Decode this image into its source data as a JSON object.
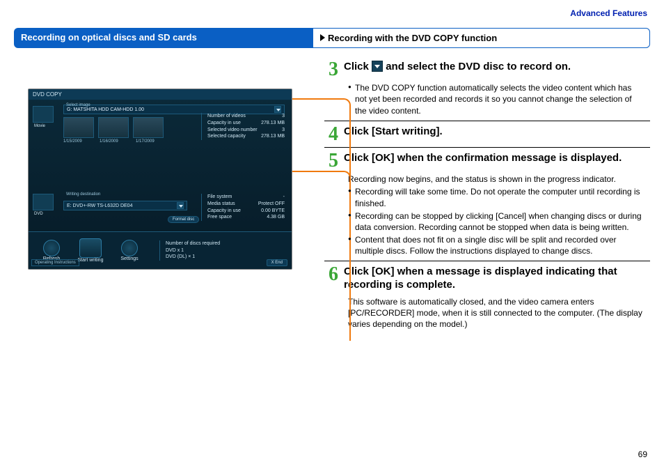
{
  "header": {
    "advanced": "Advanced Features"
  },
  "tabs": {
    "left": "Recording on optical discs and SD cards",
    "right": "Recording with the DVD COPY function"
  },
  "screenshot": {
    "title": "DVD COPY",
    "select_label": "Select image",
    "source": "G: MATSHITA HDD CAM-HDD   1.00",
    "thumbs": [
      "1/15/2009",
      "1/16/2009",
      "1/17/2009"
    ],
    "sidebar_label": "Movie",
    "stats": {
      "numvideos_l": "Number of videos",
      "numvideos_v": "3",
      "capinuse_l": "Capacity in use",
      "capinuse_v": "278.13 MB",
      "selnum_l": "Selected video number",
      "selnum_v": "3",
      "selcap_l": "Selected capacity",
      "selcap_v": "278.13 MB"
    },
    "dest_label": "Writing destination",
    "dest": "E:               DVD+-RW TS-L632D DE04",
    "format_btn": "Format disc",
    "dest_sidebar": "DVD",
    "deststats": {
      "fs_l": "File system",
      "fs_v": "-",
      "med_l": "Media status",
      "med_v": "Protect OFF",
      "cap_l": "Capacity in use",
      "cap_v": "0.00 BYTE",
      "free_l": "Free space",
      "free_v": "4.38 GB"
    },
    "bottom": {
      "refresh": "Refresh",
      "start": "Start writing",
      "settings": "Settings",
      "req_l": "Number of discs required",
      "req_v": "DVD x 1",
      "req2": "DVD (DL) × 1",
      "end": "X   End",
      "oi": "Operating Instructions"
    }
  },
  "steps": {
    "s3": {
      "num": "3",
      "title_a": "Click ",
      "title_b": " and select the DVD disc to record on.",
      "bullets": [
        "The DVD COPY function automatically selects the video content which has not yet been recorded and records it so you cannot change the selection of the video content."
      ]
    },
    "s4": {
      "num": "4",
      "title": "Click [Start writing]."
    },
    "s5": {
      "num": "5",
      "title": "Click [OK] when the confirmation message is displayed.",
      "body": "Recording now begins, and the status is shown in the progress indicator.",
      "bullets": [
        "Recording will take some time. Do not operate the computer until recording is finished.",
        "Recording can be stopped by clicking [Cancel] when changing discs or during data conversion. Recording cannot be stopped when data is being written.",
        "Content that does not fit on a single disc will be split and recorded over multiple discs. Follow the instructions displayed to change discs."
      ]
    },
    "s6": {
      "num": "6",
      "title": "Click [OK] when a message is displayed indicating that recording is complete.",
      "body": "This software is automatically closed, and the video camera enters [PC/RECORDER] mode, when it is still connected to the computer. (The display varies depending on the model.)"
    }
  },
  "page_number": "69"
}
